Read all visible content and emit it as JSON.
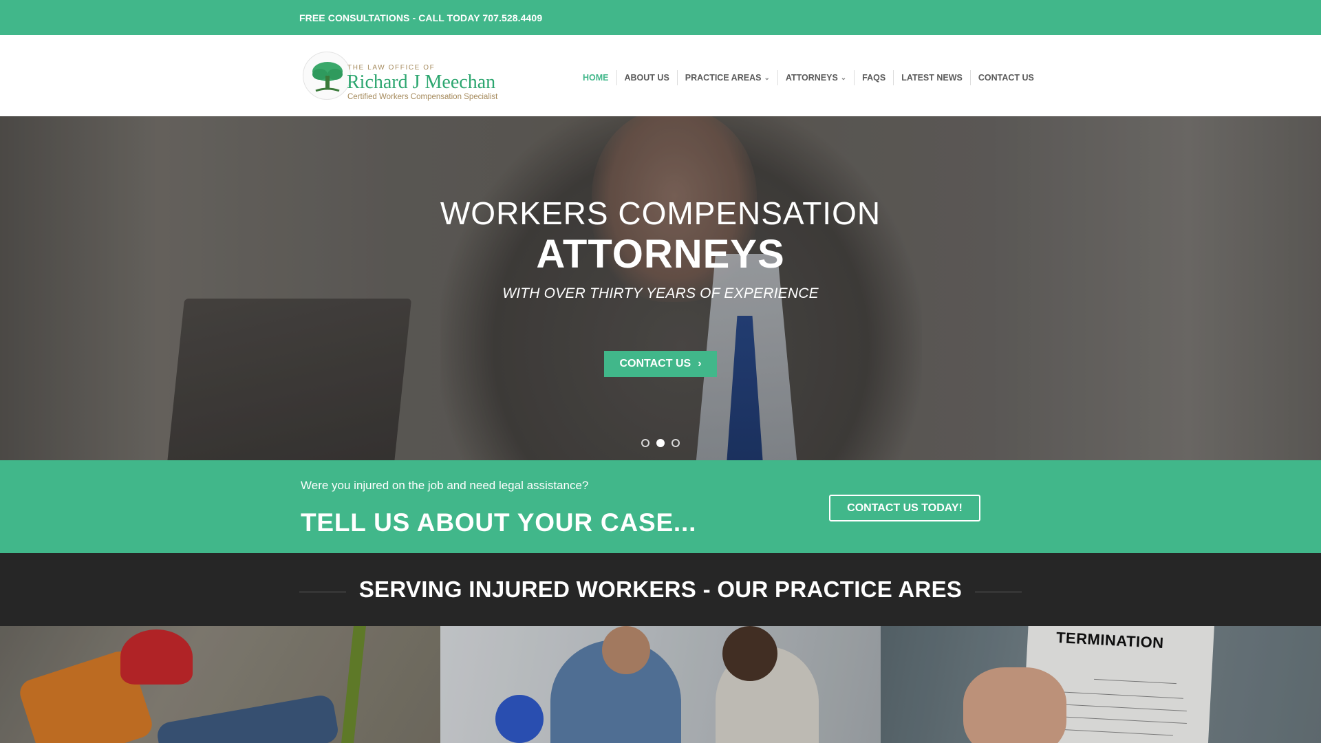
{
  "topbar": {
    "text": "FREE CONSULTATIONS - CALL TODAY 707.528.4409"
  },
  "logo": {
    "line1": "THE LAW OFFICE OF",
    "line2": "Richard J Meechan",
    "line3": "Certified Workers Compensation Specialist",
    "icon": "tree-icon"
  },
  "nav": {
    "items": [
      {
        "label": "HOME",
        "active": true,
        "dropdown": false
      },
      {
        "label": "ABOUT US",
        "active": false,
        "dropdown": false
      },
      {
        "label": "PRACTICE AREAS",
        "active": false,
        "dropdown": true
      },
      {
        "label": "ATTORNEYS",
        "active": false,
        "dropdown": true
      },
      {
        "label": "FAQS",
        "active": false,
        "dropdown": false
      },
      {
        "label": "LATEST NEWS",
        "active": false,
        "dropdown": false
      },
      {
        "label": "CONTACT US",
        "active": false,
        "dropdown": false
      }
    ],
    "caret_icon": "chevron-down-icon"
  },
  "hero": {
    "title_line1": "WORKERS COMPENSATION",
    "title_line2": "ATTORNEYS",
    "subtitle": "WITH OVER THIRTY YEARS OF EXPERIENCE",
    "button_label": "CONTACT US",
    "button_icon": "chevron-right-icon",
    "slides_total": 3,
    "active_slide": 2
  },
  "cta": {
    "question": "Were you injured on the job and need legal assistance?",
    "heading": "TELL US ABOUT YOUR CASE...",
    "button_label": "CONTACT US TODAY!"
  },
  "serving": {
    "title": "SERVING INJURED WORKERS - OUR PRACTICE ARES"
  },
  "cards": {
    "card3_document_text": "TERMINATION"
  },
  "colors": {
    "accent": "#41b78a",
    "dark_band": "#262626",
    "nav_text": "#5a5a5a",
    "logo_green": "#2ca66f",
    "logo_tan": "#a58a5c"
  }
}
